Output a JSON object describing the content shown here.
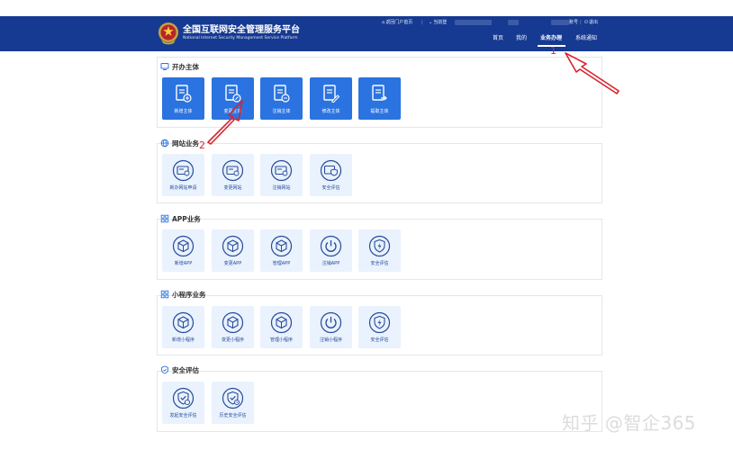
{
  "header": {
    "title": "全国互联网安全管理服务平台",
    "subtitle": "National Internet Security Management Service Platform",
    "top_links": {
      "portal": "返回门户首页",
      "current_prefix": "当前登",
      "number_suffix": "账号",
      "logout": "退出"
    },
    "nav": [
      "首页",
      "我的",
      "业务办理",
      "系统通知"
    ],
    "active_nav": "业务办理",
    "accent_color": "#163a92"
  },
  "sections": [
    {
      "title": "开办主体",
      "style": "solid",
      "items": [
        "新增主体",
        "变更主体",
        "注销主体",
        "修改主体",
        "提取主体"
      ]
    },
    {
      "title": "网站业务",
      "style": "light",
      "items": [
        "新办网站申请",
        "变更网站",
        "注销网站",
        "安全评估"
      ]
    },
    {
      "title": "APP业务",
      "style": "light",
      "items": [
        "新增APP",
        "变更APP",
        "管理APP",
        "注销APP",
        "安全评估"
      ]
    },
    {
      "title": "小程序业务",
      "style": "light",
      "items": [
        "新增小程序",
        "变更小程序",
        "管理小程序",
        "注销小程序",
        "安全评估"
      ]
    },
    {
      "title": "安全评估",
      "style": "light",
      "items": [
        "发起安全评估",
        "历史安全评估"
      ]
    }
  ],
  "annotations": [
    "1",
    "2"
  ],
  "watermark": "知乎 @智企365"
}
